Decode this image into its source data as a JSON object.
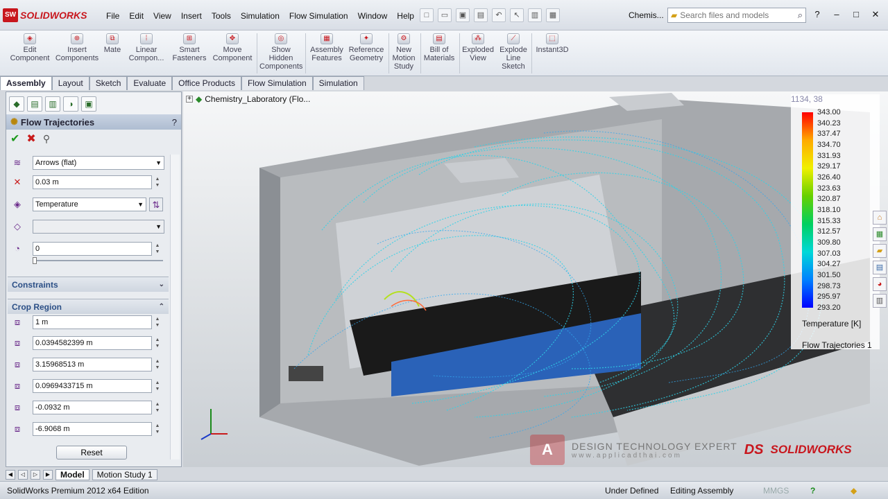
{
  "app": {
    "logo_text": "SOLIDWORKS",
    "doc_title": "Chemis..."
  },
  "menu": [
    "File",
    "Edit",
    "View",
    "Insert",
    "Tools",
    "Simulation",
    "Flow Simulation",
    "Window",
    "Help"
  ],
  "search": {
    "placeholder": "Search files and models"
  },
  "ribbon": {
    "buttons": [
      "Edit Component",
      "Insert Components",
      "Mate",
      "Linear Compon...",
      "Smart Fasteners",
      "Move Component",
      "Show Hidden Components",
      "Assembly Features",
      "Reference Geometry",
      "New Motion Study",
      "Bill of Materials",
      "Exploded View",
      "Explode Line Sketch",
      "Instant3D"
    ]
  },
  "tabs": [
    "Assembly",
    "Layout",
    "Sketch",
    "Evaluate",
    "Office Products",
    "Flow Simulation",
    "Simulation"
  ],
  "panel": {
    "title": "Flow Trajectories",
    "help": "?",
    "style_select": "Arrows (flat)",
    "size_value": "0.03 m",
    "color_by": "Temperature",
    "empty_select": "",
    "transparency_value": "0",
    "constraints_label": "Constraints",
    "crop_label": "Crop Region",
    "crop_values": [
      "1 m",
      "0.0394582399 m",
      "3.15968513 m",
      "0.0969433715 m",
      "-0.0932 m",
      "-6.9068 m"
    ],
    "reset_label": "Reset"
  },
  "bottom_tabs": [
    "Model",
    "Motion Study 1"
  ],
  "status": {
    "edition": "SolidWorks Premium 2012 x64 Edition",
    "defined": "Under Defined",
    "mode": "Editing Assembly",
    "units": "MMGS"
  },
  "viewport": {
    "tree_label": "Chemistry_Laboratory  (Flo...",
    "legend": {
      "coord": "1134, 38",
      "ticks": [
        "343.00",
        "340.23",
        "337.47",
        "334.70",
        "331.93",
        "329.17",
        "326.40",
        "323.63",
        "320.87",
        "318.10",
        "315.33",
        "312.57",
        "309.80",
        "307.03",
        "304.27",
        "301.50",
        "298.73",
        "295.97",
        "293.20"
      ],
      "unit_label": "Temperature [K]",
      "series_label": "Flow Trajectories 1"
    },
    "watermark": {
      "company": "DESIGN TECHNOLOGY EXPERT",
      "url": "www.applicadthai.com",
      "brand": "SOLIDWORKS"
    }
  }
}
